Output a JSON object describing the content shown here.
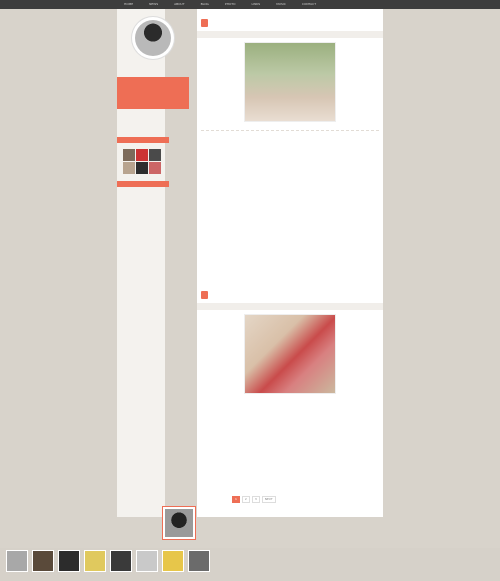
{
  "nav": {
    "items": [
      "HOME",
      "NEWS",
      "ABOUT",
      "BLOG",
      "PHOTO",
      "LINKS",
      "MUSIC",
      "CONTACT"
    ]
  },
  "sidebar": {
    "name": "",
    "description": "",
    "links": [
      "",
      "",
      ""
    ],
    "section1": "",
    "section2": "",
    "section2_links": [
      "",
      "",
      ""
    ]
  },
  "posts": [
    {
      "title": "",
      "lines_top": [
        "",
        "",
        "",
        "",
        "",
        ""
      ],
      "lines_bottom": [
        "",
        "",
        "",
        "",
        "",
        "",
        ""
      ],
      "meta": ""
    },
    {
      "title": "",
      "lines_top": [
        "",
        "",
        "",
        "",
        ""
      ],
      "lines_bottom": [
        "",
        "",
        "",
        ""
      ],
      "meta": ""
    }
  ],
  "pager": [
    "1",
    "2",
    "3",
    "NEXT"
  ],
  "footer": {
    "name": "",
    "desc1": "",
    "desc2": ""
  },
  "bottom_links": [
    "",
    "",
    "",
    ""
  ],
  "copyright": "",
  "colors": {
    "accent": "#ee6e55",
    "page_bg": "#d8d3cb",
    "panel_bg": "#ffffff"
  }
}
